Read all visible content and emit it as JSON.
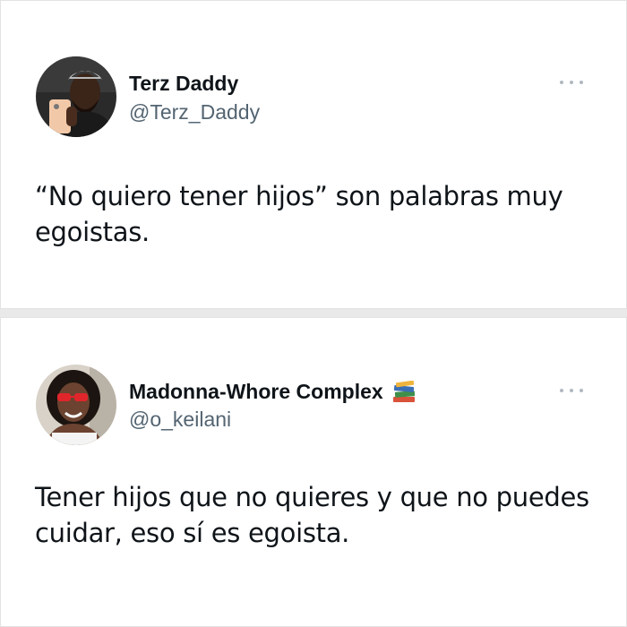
{
  "tweets": [
    {
      "display_name": "Terz Daddy",
      "handle": "@Terz_Daddy",
      "text": "“No quiero tener hijos” son palabras muy egoistas.",
      "avatar_icon": "profile-photo-man-holding-phone",
      "more_icon": "more-options-icon"
    },
    {
      "display_name": "Madonna-Whore Complex",
      "name_emoji": "books-emoji",
      "handle": "@o_keilani",
      "text": "Tener hijos que no quieres y que no puedes cuidar, eso sí es egoista.",
      "avatar_icon": "profile-photo-woman-red-sunglasses",
      "more_icon": "more-options-icon"
    }
  ],
  "colors": {
    "name": "#0f1419",
    "handle": "#536471",
    "more_dots": "#b0b8c0",
    "background": "#ffffff",
    "separator": "#e9e9e9"
  }
}
